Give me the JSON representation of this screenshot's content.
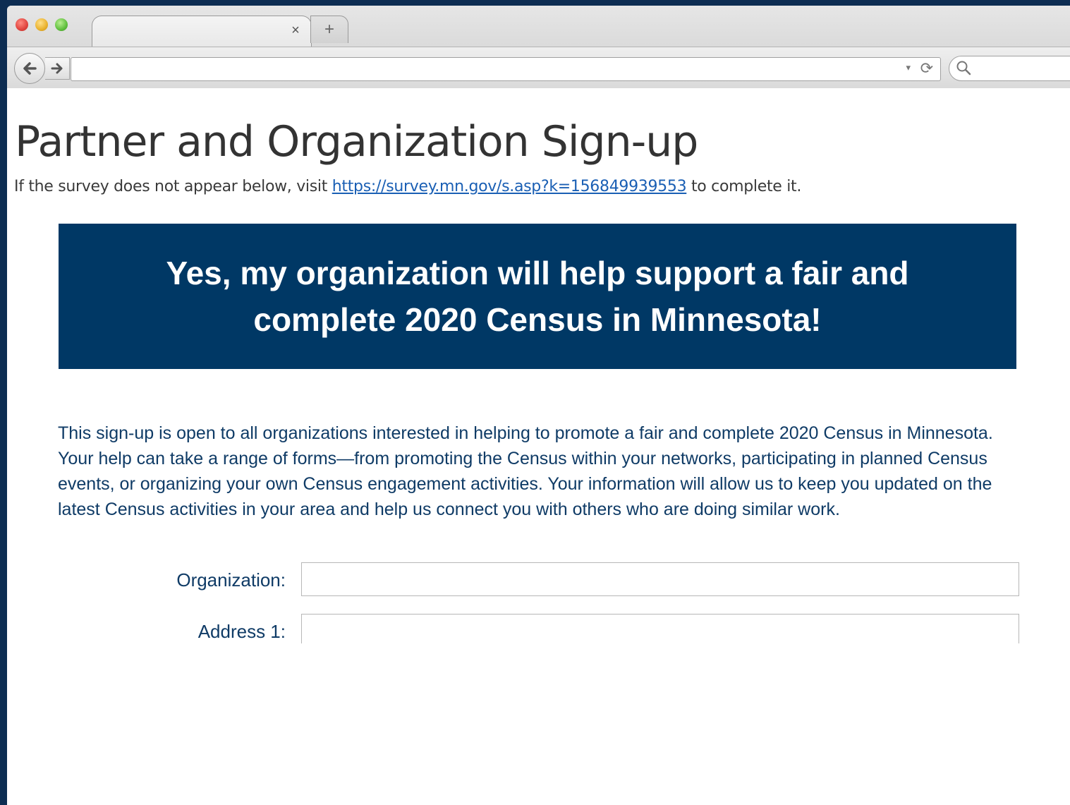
{
  "browser": {
    "tab_close_glyph": "×",
    "new_tab_glyph": "+",
    "back_glyph": "🡐",
    "forward_glyph": "🡒",
    "url_dropdown_glyph": "▾",
    "reload_glyph": "⟳"
  },
  "page": {
    "title": "Partner and Organization Sign-up",
    "intro_before": "If the survey does not appear below, visit ",
    "intro_link": "https://survey.mn.gov/s.asp?k=156849939553",
    "intro_after": " to complete it."
  },
  "banner": {
    "text": "Yes, my organization will help support a fair and complete 2020 Census in Minnesota!",
    "background": "#003865"
  },
  "form": {
    "description": "This sign-up is open to all organizations interested in helping to promote a fair and complete 2020 Census in Minnesota. Your help can take a range of forms—from promoting the Census within your networks, participating in planned Census events, or organizing your own Census engagement activities. Your information will allow us to keep you updated on the latest Census activities in your area and help us connect you with others who are doing similar work.",
    "fields": [
      {
        "label": "Organization:",
        "value": ""
      },
      {
        "label": "Address 1:",
        "value": ""
      }
    ]
  },
  "colors": {
    "outer_background": "#0d2d52",
    "text_accent": "#0f3b66",
    "link": "#1a5fb4"
  }
}
